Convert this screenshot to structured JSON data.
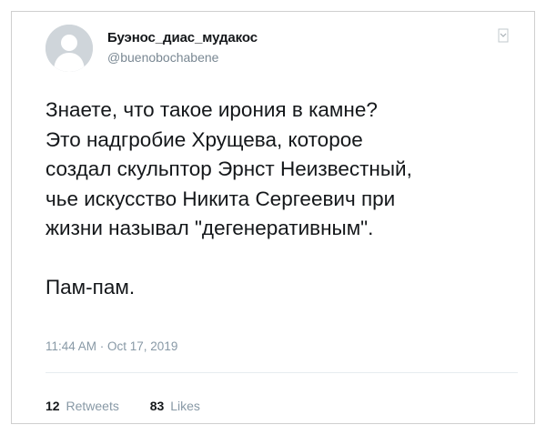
{
  "tweet": {
    "author_name": "Буэнос_диас_мудакос",
    "author_handle": "@buenobochabene",
    "lines": [
      "Знаете, что такое ирония в камне?",
      "Это надгробие Хрущева, которое",
      "создал скульптор Эрнст Неизвестный,",
      "чье искусство Никита Сергеевич при",
      "жизни называл \"дегенеративным\"."
    ],
    "last_line": "Пам-пам.",
    "timestamp": "11:44 AM · Oct 17, 2019",
    "retweets_count": "12",
    "retweets_label": "Retweets",
    "likes_count": "83",
    "likes_label": "Likes",
    "avatar_icon": "default-profile-avatar",
    "menu_icon": "chevron-menu-icon"
  },
  "colors": {
    "text": "#14171a",
    "secondary": "#8899a6",
    "avatar_bg": "#cfd5da",
    "avatar_fg": "#ffffff"
  }
}
